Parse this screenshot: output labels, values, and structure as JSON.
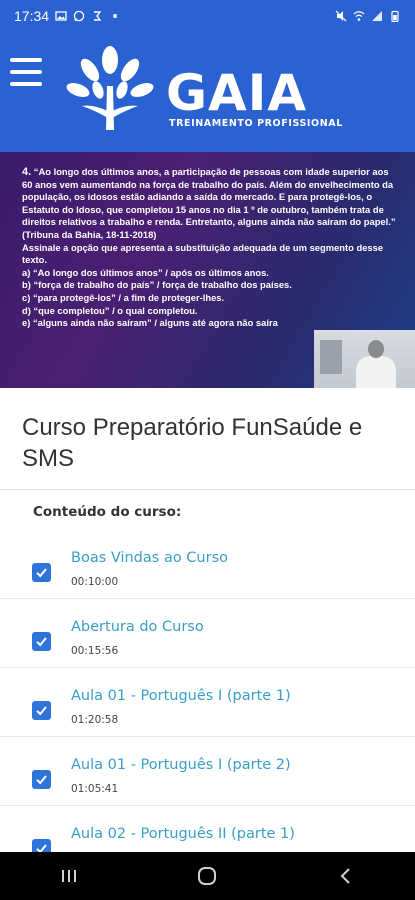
{
  "status_bar": {
    "time": "17:34",
    "icons": [
      "image-icon",
      "whatsapp-icon",
      "app-icon",
      "dot-icon",
      "mute-icon",
      "wifi-icon",
      "signal-icon",
      "battery-icon"
    ]
  },
  "header": {
    "brand": "GAIA",
    "tagline": "TREINAMENTO PROFISSIONAL",
    "menu_icon": "hamburger-icon",
    "logo_icon": "tree-icon",
    "bg_color": "#2b62d2"
  },
  "video": {
    "question_number": "4.",
    "q_para1": "“Ao longo dos últimos anos, a participação de pessoas com idade superior aos 60 anos vem aumentando na força de trabalho do país. Além do envelhecimento da população, os idosos estão adiando a saída do mercado. E para protegê-los, o Estatuto do Idoso, que completou 15 anos no dia 1 º de outubro, também trata de direitos relativos a trabalho e renda. Entretanto, alguns ainda não saíram do papel.” (Tribuna da Bahia, 18-11-2018)",
    "q_instruction": "Assinale a opção que apresenta a substituição adequada de um segmento desse texto.",
    "options": [
      "a) “Ao longo dos últimos anos” / após os últimos anos.",
      "b) “força de trabalho do país” / força de trabalho dos países.",
      "c) “para protegê-los” / a fim de proteger-lhes.",
      "d) “que completou” / o qual completou.",
      "e) “alguns ainda não saíram” / alguns até agora não saíra"
    ]
  },
  "course": {
    "title": "Curso Preparatório FunSaúde e SMS",
    "content_label": "Conteúdo do curso:",
    "lessons": [
      {
        "name": "Boas Vindas ao Curso",
        "duration": "00:10:00",
        "checked": true
      },
      {
        "name": "Abertura do Curso",
        "duration": "00:15:56",
        "checked": true
      },
      {
        "name": "Aula 01 - Português I (parte 1)",
        "duration": "01:20:58",
        "checked": true
      },
      {
        "name": "Aula 01 - Português I (parte 2)",
        "duration": "01:05:41",
        "checked": true
      },
      {
        "name": "Aula 02 - Português II (parte 1)",
        "duration": "",
        "checked": true
      }
    ],
    "accent_color": "#2f74d9",
    "lesson_color": "#3a9ec7"
  },
  "nav_bar": {
    "buttons": [
      "recents-icon",
      "home-icon",
      "back-icon"
    ]
  }
}
